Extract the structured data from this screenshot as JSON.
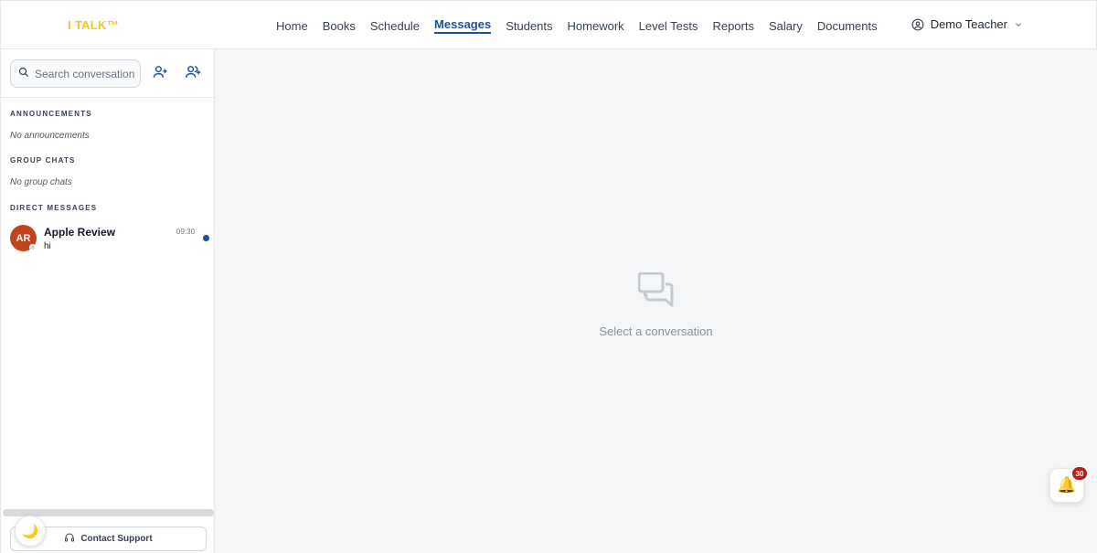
{
  "header": {
    "logo": "I TALK™",
    "nav": [
      {
        "label": "Home"
      },
      {
        "label": "Books"
      },
      {
        "label": "Schedule"
      },
      {
        "label": "Messages",
        "active": true
      },
      {
        "label": "Students"
      },
      {
        "label": "Homework"
      },
      {
        "label": "Level Tests"
      },
      {
        "label": "Reports"
      },
      {
        "label": "Salary"
      },
      {
        "label": "Documents"
      }
    ],
    "user_name": "Demo Teacher"
  },
  "sidebar": {
    "search_placeholder": "Search conversations",
    "sections": {
      "announcements": {
        "title": "ANNOUNCEMENTS",
        "empty": "No announcements"
      },
      "group_chats": {
        "title": "GROUP CHATS",
        "empty": "No group chats"
      },
      "direct_messages": {
        "title": "DIRECT MESSAGES"
      }
    },
    "direct_messages": [
      {
        "initials": "AR",
        "name": "Apple Review",
        "preview": "hi",
        "time": "09:30",
        "unread": true
      }
    ],
    "support_label": "Contact Support",
    "theme_icon": "🌙"
  },
  "main": {
    "empty_label": "Select a conversation"
  },
  "notifications": {
    "bell_icon": "🔔",
    "count": "30"
  },
  "colors": {
    "accent": "#1e4f9c",
    "logo": "#f5c518",
    "avatar": "#c0451f",
    "badge": "#b91c1c"
  }
}
